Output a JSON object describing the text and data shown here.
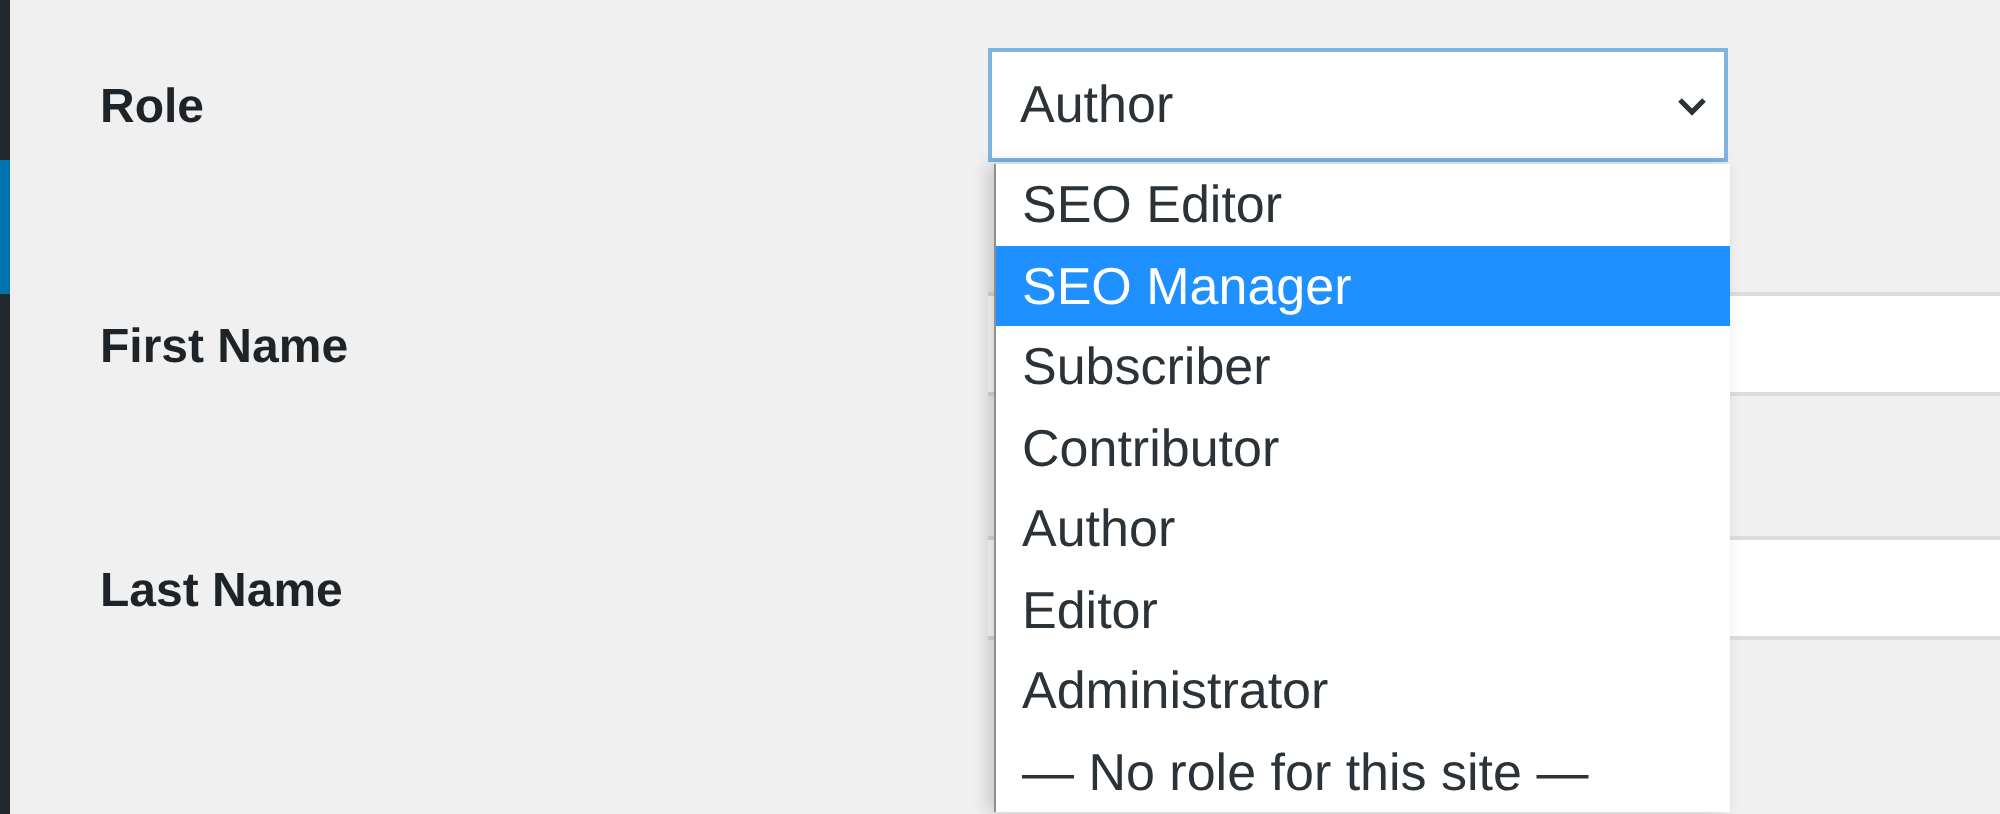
{
  "fields": [
    {
      "label": "Role",
      "kind": "select",
      "value": "Author",
      "expanded": true,
      "options": [
        {
          "label": "SEO Editor",
          "highlighted": false
        },
        {
          "label": "SEO Manager",
          "highlighted": true
        },
        {
          "label": "Subscriber",
          "highlighted": false
        },
        {
          "label": "Contributor",
          "highlighted": false
        },
        {
          "label": "Author",
          "highlighted": false
        },
        {
          "label": "Editor",
          "highlighted": false
        },
        {
          "label": "Administrator",
          "highlighted": false
        },
        {
          "label": "— No role for this site —",
          "highlighted": false
        }
      ]
    },
    {
      "label": "First Name",
      "kind": "text"
    },
    {
      "label": "Last Name",
      "kind": "text"
    }
  ]
}
